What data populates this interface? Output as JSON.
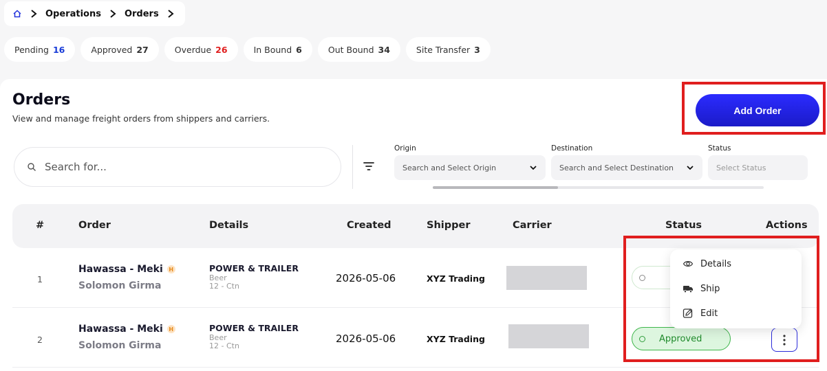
{
  "breadcrumb": {
    "items": [
      "Operations",
      "Orders"
    ]
  },
  "chips": [
    {
      "label": "Pending",
      "count": "16",
      "color": "#1a3dd8"
    },
    {
      "label": "Approved",
      "count": "27",
      "color": "#111111"
    },
    {
      "label": "Overdue",
      "count": "26",
      "color": "#e01e1e"
    },
    {
      "label": "In Bound",
      "count": "6",
      "color": "#111111"
    },
    {
      "label": "Out Bound",
      "count": "34",
      "color": "#111111"
    },
    {
      "label": "Site Transfer",
      "count": "3",
      "color": "#111111"
    }
  ],
  "page": {
    "title": "Orders",
    "subtitle": "View and manage freight orders from shippers and carriers.",
    "add_button": "Add Order"
  },
  "search": {
    "placeholder": "Search for..."
  },
  "filters": {
    "origin_label": "Origin",
    "origin_placeholder": "Search and Select Origin",
    "destination_label": "Destination",
    "destination_placeholder": "Search and Select Destination",
    "status_label": "Status",
    "status_placeholder": "Select Status"
  },
  "table": {
    "headers": [
      "#",
      "Order",
      "Details",
      "Created",
      "Shipper",
      "Carrier",
      "Status",
      "Actions"
    ],
    "rows": [
      {
        "num": "1",
        "route": "Hawassa - Meki",
        "badge": "H",
        "person": "Solomon Girma",
        "vehicle": "POWER & TRAILER",
        "item": "Beer",
        "qty": "12 - Ctn",
        "created": "2026-05-06",
        "shipper": "XYZ Trading",
        "status": ""
      },
      {
        "num": "2",
        "route": "Hawassa - Meki",
        "badge": "H",
        "person": "Solomon Girma",
        "vehicle": "POWER & TRAILER",
        "item": "Beer",
        "qty": "12 - Ctn",
        "created": "2026-05-06",
        "shipper": "XYZ Trading",
        "status": "Approved"
      }
    ]
  },
  "menu": {
    "details": "Details",
    "ship": "Ship",
    "edit": "Edit"
  },
  "colors": {
    "accent": "#1b1bc8",
    "highlight": "#e01e1e",
    "approved": "#3db54a"
  }
}
